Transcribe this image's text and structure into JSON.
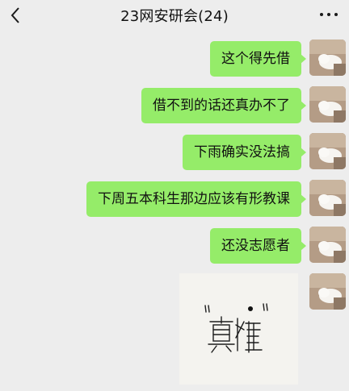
{
  "header": {
    "title": "23网安研会(24)",
    "back_icon": "chevron-left-icon",
    "more_icon": "more-dots-icon"
  },
  "messages": [
    {
      "text": "这个得先借"
    },
    {
      "text": "借不到的话还真办不了"
    },
    {
      "text": "下雨确实没法搞"
    },
    {
      "text": "下周五本科生那边应该有形教课"
    },
    {
      "text": "还没志愿者"
    }
  ],
  "image_message": {
    "content": "handwritten-characters-image"
  },
  "colors": {
    "bubble": "#95ec69",
    "background": "#ededed"
  }
}
